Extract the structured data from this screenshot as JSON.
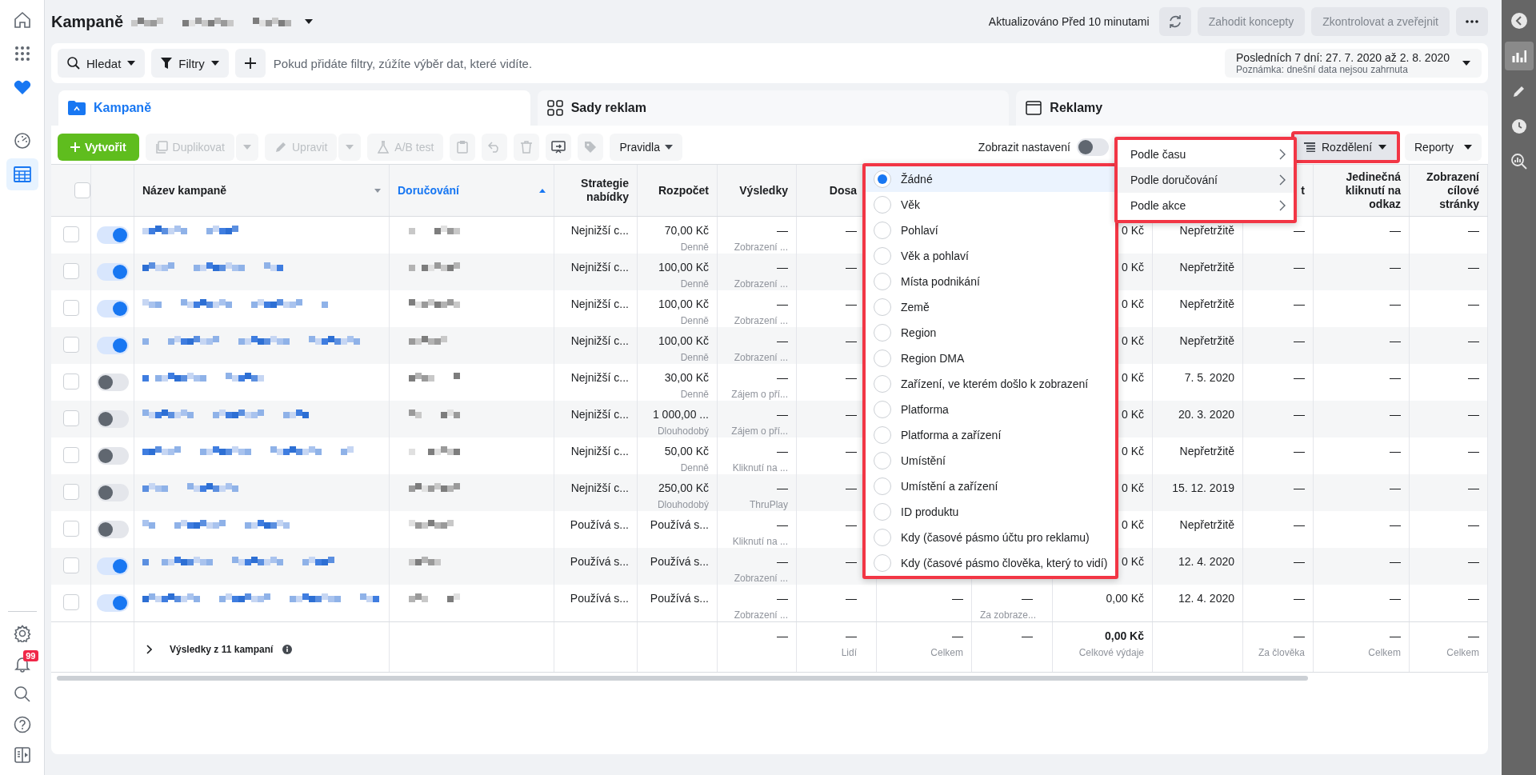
{
  "left_nav": {
    "top": [
      {
        "selected": false
      },
      {
        "selected": false
      },
      {
        "selected": false
      },
      {
        "selected": false
      },
      {
        "selected": true
      }
    ],
    "bottom": [
      {
        "selected": false
      },
      {
        "selected": false,
        "badge": "99"
      },
      {
        "selected": false
      },
      {
        "selected": false
      },
      {
        "selected": false
      }
    ]
  },
  "header": {
    "title": "Kampaně",
    "updated": "Aktualizováno Před 10 minutami",
    "buttons": [
      {
        "label": "Zahodit koncepty",
        "disabled": true
      },
      {
        "label": "Zkontrolovat a zveřejnit",
        "disabled": true
      }
    ]
  },
  "filter_bar": {
    "search": "Hledat",
    "filters": "Filtry",
    "placeholder": "Pokud přidáte filtry, zúžíte výběr dat, které vidíte.",
    "date_range": "Posledních 7 dní: 27. 7. 2020 až 2. 8. 2020",
    "date_note": "Poznámka: dnešní data nejsou zahrnuta"
  },
  "tabs": [
    {
      "label": "Kampaně",
      "selected": true
    },
    {
      "label": "Sady reklam",
      "selected": false
    },
    {
      "label": "Reklamy",
      "selected": false
    }
  ],
  "toolbar": {
    "create": "Vytvořit",
    "actions": [
      {
        "kind": "split",
        "label": "Duplikovat",
        "disabled": true
      },
      {
        "kind": "split",
        "label": "Upravit",
        "disabled": true
      },
      {
        "kind": "button",
        "label": "A/B test",
        "disabled": true
      },
      {
        "kind": "icon",
        "disabled": true
      },
      {
        "kind": "icon",
        "disabled": true
      },
      {
        "kind": "icon",
        "disabled": true
      },
      {
        "kind": "icon",
        "disabled": false
      },
      {
        "kind": "icon",
        "disabled": true
      },
      {
        "kind": "menu",
        "label": "Pravidla",
        "disabled": false
      }
    ],
    "settings_label": "Zobrazit nastavení",
    "settings_on": false,
    "breakdown": {
      "label": "Rozdělení",
      "highlight_box": true
    },
    "reports": "Reporty"
  },
  "table": {
    "select_all_checked": false,
    "columns": [
      {
        "label": "Název kampaně",
        "sorted": false
      },
      {
        "label": "Doručování",
        "sorted": true
      },
      {
        "label": "Strategie nabídky"
      },
      {
        "label": "Rozpočet"
      },
      {
        "label": "Výsledky"
      },
      {
        "label": "Dosa"
      },
      {},
      {},
      {},
      {},
      {
        "label": "t"
      },
      {
        "label": "Jedinečná kliknutí na odkaz"
      },
      {
        "label": "Zobrazení cílové stránky"
      }
    ],
    "rows": [
      {
        "checked": false,
        "on": true,
        "cells": [
          {},
          {},
          {
            "value": "Nejnižší c..."
          },
          {
            "value": "70,00 Kč",
            "sub": "Denně"
          },
          {
            "value": "—",
            "sub": "Zobrazení ..."
          },
          {
            "value": "—"
          },
          {},
          {},
          {
            "value": "0 Kč"
          },
          {
            "value": "Nepřetržitě"
          },
          {
            "value": "—"
          },
          {
            "value": "—"
          },
          {
            "value": "—"
          }
        ]
      },
      {
        "checked": false,
        "on": true,
        "cells": [
          {},
          {},
          {
            "value": "Nejnižší c..."
          },
          {
            "value": "100,00 Kč",
            "sub": "Denně"
          },
          {
            "value": "—",
            "sub": "Zobrazení ..."
          },
          {
            "value": "—"
          },
          {},
          {},
          {
            "value": "0 Kč"
          },
          {
            "value": "Nepřetržitě"
          },
          {
            "value": "—"
          },
          {
            "value": "—"
          },
          {
            "value": "—"
          }
        ]
      },
      {
        "checked": false,
        "on": true,
        "cells": [
          {},
          {},
          {
            "value": "Nejnižší c..."
          },
          {
            "value": "100,00 Kč",
            "sub": "Denně"
          },
          {
            "value": "—",
            "sub": "Zobrazení ..."
          },
          {
            "value": "—"
          },
          {},
          {},
          {
            "value": "0 Kč"
          },
          {
            "value": "Nepřetržitě"
          },
          {
            "value": "—"
          },
          {
            "value": "—"
          },
          {
            "value": "—"
          }
        ]
      },
      {
        "checked": false,
        "on": true,
        "cells": [
          {},
          {},
          {
            "value": "Nejnižší c..."
          },
          {
            "value": "100,00 Kč",
            "sub": "Denně"
          },
          {
            "value": "—",
            "sub": "Zobrazení ..."
          },
          {
            "value": "—"
          },
          {},
          {},
          {
            "value": "0 Kč"
          },
          {
            "value": "Nepřetržitě"
          },
          {
            "value": "—"
          },
          {
            "value": "—"
          },
          {
            "value": "—"
          }
        ]
      },
      {
        "checked": false,
        "on": false,
        "cells": [
          {},
          {},
          {
            "value": "Nejnižší c..."
          },
          {
            "value": "30,00 Kč",
            "sub": "Denně"
          },
          {
            "value": "—",
            "sub": "Zájem o pří..."
          },
          {
            "value": "—"
          },
          {},
          {},
          {
            "value": "0 Kč"
          },
          {
            "value": "7. 5. 2020"
          },
          {
            "value": "—"
          },
          {
            "value": "—"
          },
          {
            "value": "—"
          }
        ]
      },
      {
        "checked": false,
        "on": false,
        "cells": [
          {},
          {},
          {
            "value": "Nejnižší c..."
          },
          {
            "value": "1 000,00 ...",
            "sub": "Dlouhodobý"
          },
          {
            "value": "—",
            "sub": "Zájem o pří..."
          },
          {
            "value": "—"
          },
          {},
          {},
          {
            "value": "0 Kč"
          },
          {
            "value": "20. 3. 2020"
          },
          {
            "value": "—"
          },
          {
            "value": "—"
          },
          {
            "value": "—"
          }
        ]
      },
      {
        "checked": false,
        "on": false,
        "cells": [
          {},
          {},
          {
            "value": "Nejnižší c..."
          },
          {
            "value": "50,00 Kč",
            "sub": "Denně"
          },
          {
            "value": "—",
            "sub": "Kliknutí na ..."
          },
          {
            "value": "—"
          },
          {},
          {},
          {
            "value": "0 Kč"
          },
          {
            "value": "Nepřetržitě"
          },
          {
            "value": "—"
          },
          {
            "value": "—"
          },
          {
            "value": "—"
          }
        ]
      },
      {
        "checked": false,
        "on": false,
        "cells": [
          {},
          {},
          {
            "value": "Nejnižší c..."
          },
          {
            "value": "250,00 Kč",
            "sub": "Dlouhodobý"
          },
          {
            "value": "—",
            "sub": "ThruPlay"
          },
          {
            "value": "—"
          },
          {},
          {},
          {
            "value": "0 Kč"
          },
          {
            "value": "15. 12. 2019"
          },
          {
            "value": "—"
          },
          {
            "value": "—"
          },
          {
            "value": "—"
          }
        ]
      },
      {
        "checked": false,
        "on": false,
        "cells": [
          {},
          {},
          {
            "value": "Používá s..."
          },
          {
            "value": "Používá s..."
          },
          {
            "value": "—",
            "sub": "Kliknutí na ..."
          },
          {
            "value": "—"
          },
          {},
          {},
          {
            "value": "0 Kč"
          },
          {
            "value": "Nepřetržitě"
          },
          {
            "value": "—"
          },
          {
            "value": "—"
          },
          {
            "value": "—"
          }
        ]
      },
      {
        "checked": false,
        "on": true,
        "cells": [
          {},
          {},
          {
            "value": "Používá s..."
          },
          {
            "value": "Používá s..."
          },
          {
            "value": "—",
            "sub": "Zobrazení ..."
          },
          {
            "value": "—"
          },
          {},
          {},
          {
            "value": "0 Kč"
          },
          {
            "value": "12. 4. 2020"
          },
          {
            "value": "—"
          },
          {
            "value": "—"
          },
          {
            "value": "—"
          }
        ]
      },
      {
        "checked": false,
        "on": true,
        "cells": [
          {},
          {},
          {
            "value": "Používá s..."
          },
          {
            "value": "Používá s..."
          },
          {
            "value": "—",
            "sub": "Zobrazení ..."
          },
          {
            "value": "—"
          },
          {
            "value": "—"
          },
          {
            "value": "—",
            "sub": "Za zobraze..."
          },
          {
            "value": "0,00 Kč"
          },
          {
            "value": "12. 4. 2020"
          },
          {
            "value": "—"
          },
          {
            "value": "—"
          },
          {
            "value": "—"
          }
        ]
      }
    ],
    "totals": {
      "label": "Výsledky z 11 kampaní",
      "cells": [
        {},
        {},
        {},
        {},
        {
          "value": "—"
        },
        {
          "value": "—",
          "sub": "Lidí"
        },
        {
          "value": "—",
          "sub": "Celkem"
        },
        {
          "value": "—"
        },
        {
          "value": "0,00 Kč",
          "sub": "Celkové výdaje",
          "bold": true
        },
        {},
        {
          "value": "—",
          "sub": "Za člověka"
        },
        {
          "value": "—",
          "sub": "Celkem"
        },
        {
          "value": "—",
          "sub": "Celkem"
        }
      ]
    }
  },
  "breakdown_menu": {
    "highlight_box": true,
    "items": [
      {
        "label": "Žádné",
        "selected": true
      },
      {
        "label": "Věk",
        "selected": false
      },
      {
        "label": "Pohlaví",
        "selected": false
      },
      {
        "label": "Věk a pohlaví",
        "selected": false
      },
      {
        "label": "Místa podnikání",
        "selected": false
      },
      {
        "label": "Země",
        "selected": false
      },
      {
        "label": "Region",
        "selected": false
      },
      {
        "label": "Region DMA",
        "selected": false
      },
      {
        "label": "Zařízení, ve kterém došlo k zobrazení",
        "selected": false
      },
      {
        "label": "Platforma",
        "selected": false
      },
      {
        "label": "Platforma a zařízení",
        "selected": false
      },
      {
        "label": "Umístění",
        "selected": false
      },
      {
        "label": "Umístění a zařízení",
        "selected": false
      },
      {
        "label": "ID produktu",
        "selected": false
      },
      {
        "label": "Kdy (časové pásmo účtu pro reklamu)",
        "selected": false
      },
      {
        "label": "Kdy (časové pásmo člověka, který to vidí)",
        "selected": false
      }
    ]
  },
  "breakdown_submenu": {
    "highlight_box": true,
    "items": [
      {
        "label": "Podle času",
        "selected": false
      },
      {
        "label": "Podle doručování",
        "selected": true
      },
      {
        "label": "Podle akce",
        "selected": false
      }
    ]
  },
  "side_panel": {
    "items": [
      {
        "selected": false
      },
      {
        "selected": true
      },
      {
        "selected": false
      },
      {
        "selected": false
      },
      {
        "selected": false
      }
    ]
  }
}
